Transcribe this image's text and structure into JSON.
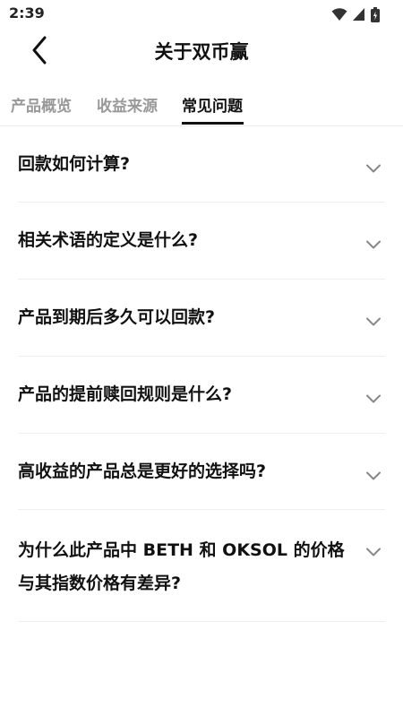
{
  "status_bar": {
    "time": "2:39",
    "icons": [
      "wifi-icon",
      "cell-signal-icon",
      "battery-icon"
    ]
  },
  "header": {
    "title": "关于双币赢",
    "back_icon": "chevron-left-icon"
  },
  "tabs": [
    {
      "label": "产品概览",
      "active": false
    },
    {
      "label": "收益来源",
      "active": false
    },
    {
      "label": "常见问题",
      "active": true
    }
  ],
  "faq": [
    {
      "question": "回款如何计算?"
    },
    {
      "question": "相关术语的定义是什么?"
    },
    {
      "question": "产品到期后多久可以回款?"
    },
    {
      "question": "产品的提前赎回规则是什么?"
    },
    {
      "question": "高收益的产品总是更好的选择吗?"
    },
    {
      "question": "为什么此产品中 BETH 和 OKSOL 的价格与其指数价格有差异?",
      "lines": [
        "为什么此产品中 BETH 和 OKSOL 的价格",
        "与其指数价格有差异?"
      ]
    }
  ],
  "colors": {
    "text_primary": "#111111",
    "text_inactive_tab": "#999999",
    "divider": "#eeeeee",
    "chevron": "#888888"
  }
}
